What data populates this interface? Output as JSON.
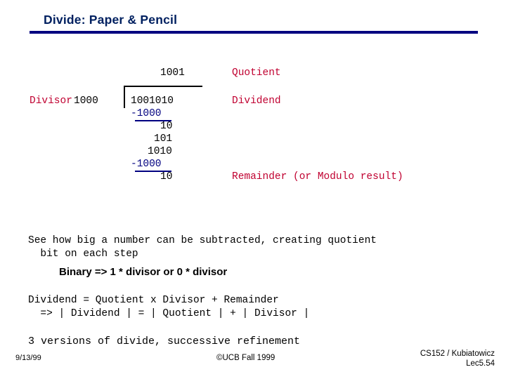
{
  "slide": {
    "title": "Divide: Paper & Pencil",
    "colors": {
      "title": "#002060",
      "rule": "#000080",
      "label": "#c00030",
      "subtract": "#000080",
      "text": "#000000"
    },
    "division": {
      "quotient_digits": "1001",
      "quotient_label": "Quotient",
      "divisor_label": "Divisor",
      "divisor_value": "1000",
      "dividend_value": "1001010",
      "dividend_label": "Dividend",
      "subtract_1": "-1000",
      "partial_1": "10",
      "partial_2": "101",
      "partial_3": "1010",
      "subtract_2": "-1000",
      "remainder_value": "10",
      "remainder_label": "Remainder (or Modulo result)"
    },
    "notes": {
      "see_how": "See how big a number can be subtracted, creating quotient\n  bit on each step",
      "binary": "Binary => 1 * divisor or 0 * divisor",
      "dividend_eq": "Dividend = Quotient x Divisor + Remainder\n  => | Dividend | = | Quotient | + | Divisor |",
      "versions": "3 versions of divide, successive refinement"
    },
    "footer": {
      "date": "9/13/99",
      "center": "©UCB Fall 1999",
      "right_line1": "CS152 / Kubiatowicz",
      "right_line2": "Lec5.54"
    }
  }
}
